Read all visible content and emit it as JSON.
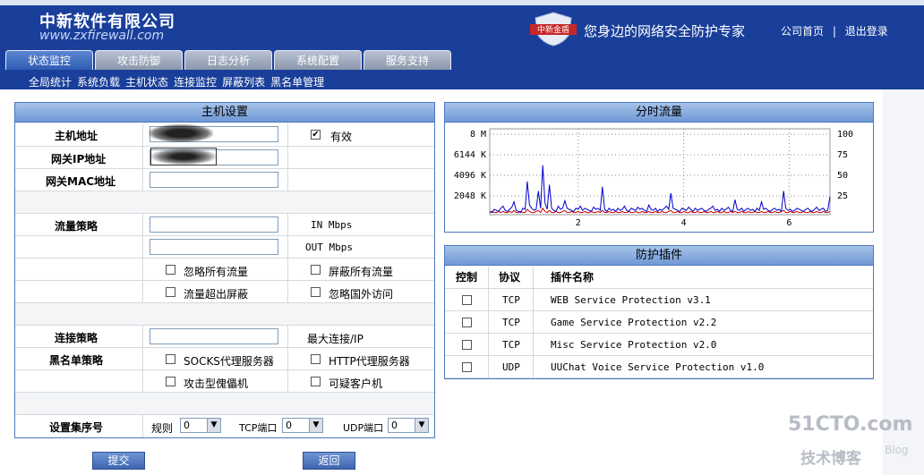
{
  "header": {
    "company_cn": "中新软件有限公司",
    "company_url": "www.zxfirewall.com",
    "brand_badge": "中新金盾",
    "slogan": "您身边的网络安全防护专家",
    "link_home": "公司首页",
    "separator": "|",
    "link_logout": "退出登录"
  },
  "tabs": [
    {
      "label": "状态监控",
      "active": true
    },
    {
      "label": "攻击防御",
      "active": false
    },
    {
      "label": "日志分析",
      "active": false
    },
    {
      "label": "系统配置",
      "active": false
    },
    {
      "label": "服务支持",
      "active": false
    }
  ],
  "subnav": [
    "全局统计",
    "系统负载",
    "主机状态",
    "连接监控",
    "屏蔽列表",
    "黑名单管理"
  ],
  "host_panel": {
    "title": "主机设置",
    "host_addr_label": "主机地址",
    "valid_label": "有效",
    "valid_checked": true,
    "gw_ip_label": "网关IP地址",
    "gw_mac_label": "网关MAC地址",
    "traffic_label": "流量策略",
    "in_unit": "IN Mbps",
    "out_unit": "OUT Mbps",
    "ignore_all": "忽略所有流量",
    "block_all": "屏蔽所有流量",
    "over_block": "流量超出屏蔽",
    "ignore_foreign": "忽略国外访问",
    "conn_label": "连接策略",
    "max_conn": "最大连接/IP",
    "blacklist_label": "黑名单策略",
    "socks": "SOCKS代理服务器",
    "http": "HTTP代理服务器",
    "zombie": "攻击型傀儡机",
    "suspicious": "可疑客户机",
    "cluster_label": "设置集序号",
    "rule_label": "规则",
    "rule_value": "0",
    "tcp_label": "TCP端口",
    "tcp_value": "0",
    "udp_label": "UDP端口",
    "udp_value": "0"
  },
  "buttons": {
    "submit": "提交",
    "back": "返回"
  },
  "traffic_panel": {
    "title": "分时流量",
    "y_left": [
      "8 M",
      "6144 K",
      "4096 K",
      "2048 K"
    ],
    "y_right": [
      "100",
      "75",
      "50",
      "25"
    ],
    "x_ticks": [
      "2",
      "4",
      "6"
    ]
  },
  "chart_data": {
    "type": "line",
    "title": "分时流量",
    "x_ticks": [
      "2",
      "4",
      "6"
    ],
    "y_ticks_left": [
      "8 M",
      "6144 K",
      "4096 K",
      "2048 K"
    ],
    "y_ticks_right": [
      "100",
      "75",
      "50",
      "25"
    ],
    "series": [
      {
        "color": "#0000cc",
        "values": [
          0.3,
          0.2,
          0.5,
          0.4,
          0.3,
          0.6,
          0.8,
          0.4,
          0.3,
          0.5,
          0.7,
          1.2,
          0.4,
          0.3,
          0.2,
          0.6,
          0.5,
          3.1,
          0.9,
          0.6,
          0.4,
          0.5,
          2.2,
          0.6,
          4.6,
          1.1,
          0.5,
          2.8,
          0.6,
          0.4,
          0.3,
          0.8,
          0.5,
          0.6,
          1.3,
          0.6,
          0.5,
          0.4,
          0.3,
          0.6,
          0.5,
          0.8,
          0.4,
          0.6,
          0.5,
          0.4,
          0.3,
          0.7,
          0.5,
          0.6,
          0.4,
          2.6,
          0.5,
          0.3,
          0.6,
          0.4,
          0.5,
          0.3,
          0.6,
          0.4,
          0.5,
          0.8,
          0.4,
          0.3,
          0.6,
          0.5,
          0.4,
          0.7,
          0.5,
          0.6,
          0.4,
          0.3,
          0.9,
          0.5,
          0.4,
          0.6,
          0.3,
          0.5,
          0.4,
          0.6,
          0.8,
          0.5,
          2.0,
          0.6,
          0.5,
          0.4,
          0.3,
          0.6,
          0.5,
          0.4,
          0.7,
          0.5,
          0.3,
          0.6,
          0.4,
          0.5,
          0.6,
          0.4,
          0.3,
          0.5,
          0.6,
          0.8,
          0.4,
          0.5,
          0.3,
          0.6,
          0.4,
          0.5,
          0.7,
          0.4,
          0.3,
          1.4,
          0.5,
          0.4,
          0.6,
          0.3,
          0.5,
          0.6,
          0.4,
          0.5,
          0.3,
          0.6,
          0.4,
          1.2,
          0.5,
          0.6,
          0.4,
          0.3,
          0.5,
          0.6,
          0.4,
          0.5,
          0.3,
          2.2,
          0.6,
          0.4,
          0.5,
          0.3,
          0.4,
          0.6,
          0.5,
          0.4,
          0.3,
          0.5,
          0.6,
          0.4,
          0.3,
          0.5,
          0.7,
          0.4,
          0.5,
          0.6,
          0.3,
          0.4,
          1.7
        ]
      },
      {
        "color": "#cc0000",
        "values": [
          0.2,
          0.3,
          0.2,
          0.2,
          0.3,
          0.2,
          0.3,
          0.2,
          0.2,
          0.3,
          0.2,
          0.4,
          0.2,
          0.2,
          0.3,
          0.2,
          0.2,
          0.5,
          0.3,
          0.2,
          0.2,
          0.3,
          0.4,
          0.2,
          0.6,
          0.3,
          0.2,
          0.4,
          0.2,
          0.2,
          0.3,
          0.2,
          0.2,
          0.3,
          0.4,
          0.2,
          0.2,
          0.3,
          0.2,
          0.2,
          0.3,
          0.2,
          0.2,
          0.3,
          0.2,
          0.2,
          0.3,
          0.2,
          0.2,
          0.3,
          0.2,
          0.4,
          0.2,
          0.2,
          0.3,
          0.2,
          0.2,
          0.3,
          0.2,
          0.2,
          0.3,
          0.2,
          0.2,
          0.3,
          0.2,
          0.2,
          0.3,
          0.2,
          0.2,
          0.3,
          0.2,
          0.2,
          0.3,
          0.2,
          0.2,
          0.3,
          0.2,
          0.2,
          0.3,
          0.2,
          0.2,
          0.3,
          0.4,
          0.2,
          0.2,
          0.3,
          0.2,
          0.2,
          0.3,
          0.2,
          0.2,
          0.3,
          0.2,
          0.2,
          0.3,
          0.2,
          0.2,
          0.3,
          0.2,
          0.2,
          0.3,
          0.2,
          0.2,
          0.3,
          0.2,
          0.2,
          0.3,
          0.2,
          0.2,
          0.3,
          0.2,
          0.3,
          0.2,
          0.2,
          0.3,
          0.2,
          0.2,
          0.3,
          0.2,
          0.2,
          0.3,
          0.2,
          0.2,
          0.3,
          0.2,
          0.2,
          0.3,
          0.2,
          0.2,
          0.3,
          0.2,
          0.2,
          0.3,
          0.4,
          0.2,
          0.2,
          0.3,
          0.2,
          0.2,
          0.3,
          0.2,
          0.2,
          0.3,
          0.2,
          0.2,
          0.3,
          0.2,
          0.2,
          0.3,
          0.2,
          0.2,
          0.3,
          0.2,
          0.2,
          0.3
        ]
      }
    ]
  },
  "plugin_panel": {
    "title": "防护插件",
    "headers": [
      "控制",
      "协议",
      "插件名称"
    ],
    "rows": [
      {
        "protocol": "TCP",
        "name": "WEB Service Protection v3.1"
      },
      {
        "protocol": "TCP",
        "name": "Game Service Protection v2.2"
      },
      {
        "protocol": "TCP",
        "name": "Misc Service Protection v2.0"
      },
      {
        "protocol": "UDP",
        "name": "UUChat Voice Service Protection v1.0"
      }
    ]
  },
  "watermark": {
    "site": "51CTO.com",
    "sub": "技术博客",
    "blog": "Blog"
  },
  "colors": {
    "header_bg": "#1a3f9a",
    "panel_border": "#4b79be",
    "tab_active": "#2f5cb3",
    "series_blue": "#0000cc",
    "series_red": "#cc0000"
  }
}
